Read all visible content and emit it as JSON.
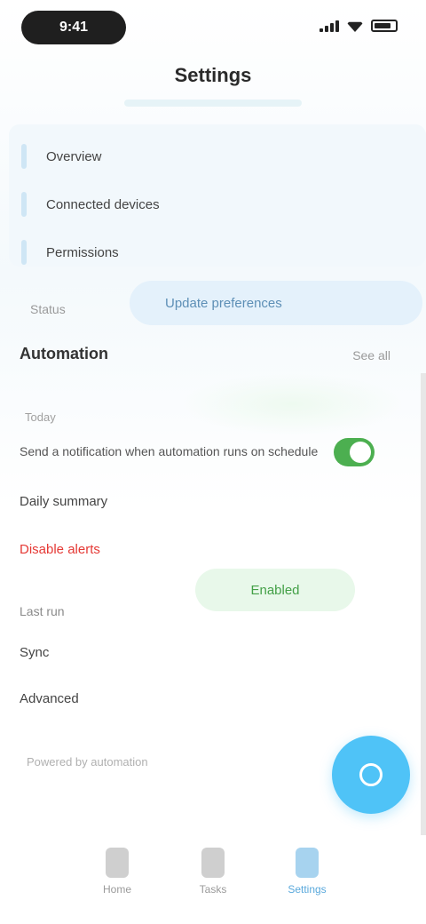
{
  "status_bar": {
    "time": "9:41"
  },
  "header": {
    "title": "Settings"
  },
  "info_card": {
    "rows": [
      {
        "label": "Overview"
      },
      {
        "label": "Connected devices"
      },
      {
        "label": "Permissions"
      }
    ]
  },
  "primary_action": {
    "label": "Update preferences"
  },
  "left_hint": "Status",
  "section": {
    "title": "Automation",
    "link": "See all"
  },
  "small_label": "Today",
  "long_row": "Send a notification when automation runs on schedule",
  "rows": {
    "a": "Daily summary",
    "warn": "Disable alerts",
    "b": "Last run",
    "c": "Sync",
    "d": "Advanced",
    "footer": "Powered by automation"
  },
  "green_button": {
    "label": "Enabled"
  },
  "toggle": {
    "on": true
  },
  "nav": [
    {
      "label": "Home"
    },
    {
      "label": "Tasks"
    },
    {
      "label": "Settings"
    }
  ],
  "colors": {
    "accent": "#4fc3f7",
    "success": "#4caf50",
    "danger": "#e53935"
  }
}
